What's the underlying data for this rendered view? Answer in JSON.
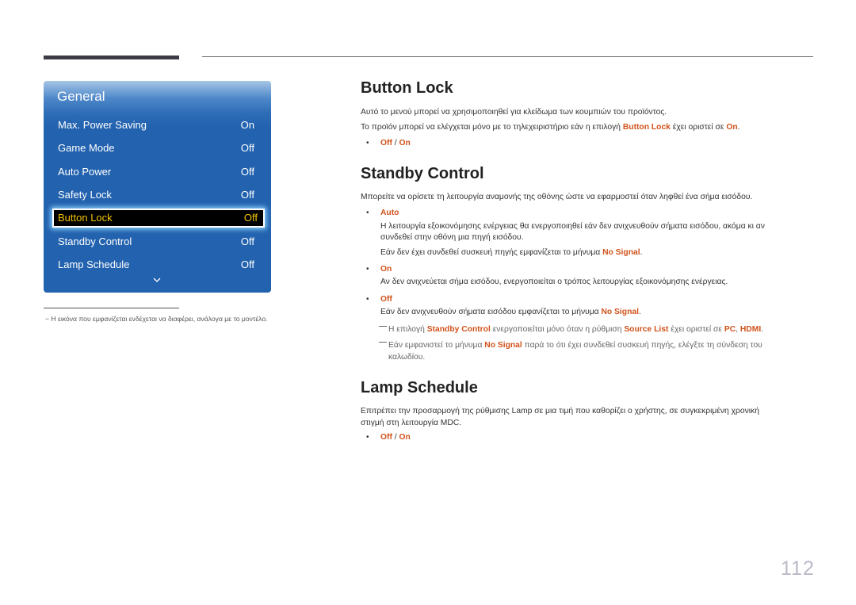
{
  "osd": {
    "title": "General",
    "items": [
      {
        "label": "Max. Power Saving",
        "value": "On"
      },
      {
        "label": "Game Mode",
        "value": "Off"
      },
      {
        "label": "Auto Power",
        "value": "Off"
      },
      {
        "label": "Safety Lock",
        "value": "Off"
      },
      {
        "label": "Button Lock",
        "value": "Off",
        "selected": true
      },
      {
        "label": "Standby Control",
        "value": "Off"
      },
      {
        "label": "Lamp Schedule",
        "value": "Off"
      }
    ],
    "colors": {
      "panel": "#2262ae",
      "selected_text": "#f3c400"
    }
  },
  "image_note": "Η εικόνα που εμφανίζεται ενδέχεται να διαφέρει, ανάλογα με το μοντέλο.",
  "button_lock": {
    "title": "Button Lock",
    "p1": "Αυτό το μενού μπορεί να χρησιμοποιηθεί για κλείδωμα των κουμπιών του προϊόντος.",
    "p2_a": "Το προϊόν μπορεί να ελέγχεται μόνο με το τηλεχειριστήριο εάν η επιλογή ",
    "p2_b": "Button Lock",
    "p2_c": " έχει οριστεί σε ",
    "p2_d": "On",
    "p2_e": ".",
    "opt_off": "Off",
    "opt_sep": " / ",
    "opt_on": "On"
  },
  "standby": {
    "title": "Standby Control",
    "intro": "Μπορείτε να ορίσετε τη λειτουργία αναμονής της οθόνης ώστε να εφαρμοστεί όταν ληφθεί ένα σήμα εισόδου.",
    "auto_label": "Auto",
    "auto_text_1": "Η λειτουργία εξοικονόμησης ενέργειας θα ενεργοποιηθεί εάν δεν ανιχνευθούν σήματα εισόδου, ακόμα κι αν",
    "auto_text_2": "συνδεθεί στην οθόνη μια πηγή εισόδου.",
    "auto_text_3a": "Εάν δεν έχει συνδεθεί συσκευή πηγής εμφανίζεται το μήνυμα ",
    "auto_text_3b": "No Signal",
    "auto_text_3c": ".",
    "on_label": "On",
    "on_text": "Αν δεν ανιχνεύεται σήμα εισόδου, ενεργοποιείται ο τρόπος λειτουργίας εξοικονόμησης ενέργειας.",
    "off_label": "Off",
    "off_text_a": "Εάν δεν ανιχνευθούν σήματα εισόδου εμφανίζεται το μήνυμα ",
    "off_text_b": "No Signal",
    "off_text_c": ".",
    "note1_a": "Η επιλογή ",
    "note1_b": "Standby Control",
    "note1_c": " ενεργοποιείται μόνο όταν η ρύθμιση ",
    "note1_d": "Source List",
    "note1_e": " έχει οριστεί σε ",
    "note1_f": "PC",
    "note1_g": ", ",
    "note1_h": "HDMI",
    "note1_i": ".",
    "note2_a": "Εάν εμφανιστεί το μήνυμα ",
    "note2_b": "No Signal",
    "note2_c": " παρά το ότι έχει συνδεθεί συσκευή πηγής, ελέγξτε τη σύνδεση του",
    "note2_d": "καλωδίου."
  },
  "lamp": {
    "title": "Lamp Schedule",
    "p1": "Επιτρέπει την προσαρμογή της ρύθμισης Lamp σε μια τιμή που καθορίζει ο χρήστης, σε συγκεκριμένη χρονική",
    "p2": "στιγμή στη λειτουργία MDC.",
    "opt_off": "Off",
    "opt_sep": " / ",
    "opt_on": "On"
  },
  "page_number": "112",
  "accent_color": "#d1521a"
}
